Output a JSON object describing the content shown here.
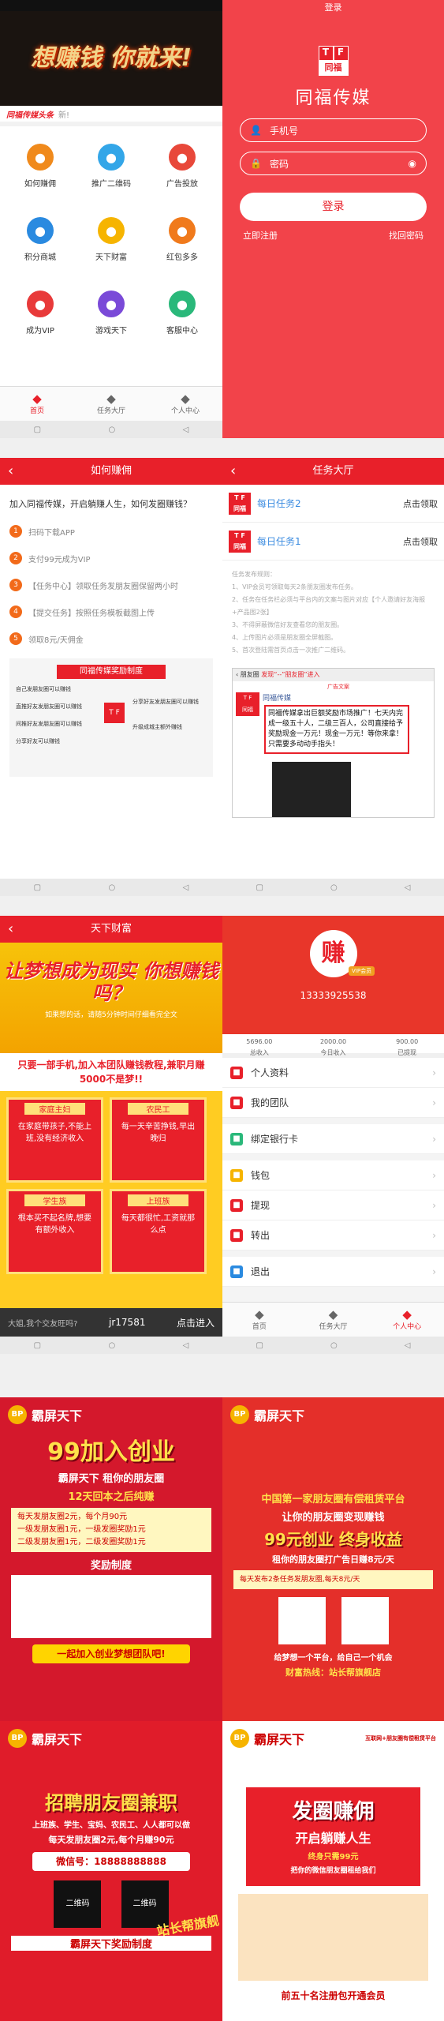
{
  "colors": {
    "brand_red": "#e8202a",
    "link_blue": "#3a8be0",
    "gold": "#f2d48a"
  },
  "panelA": {
    "banner": "想赚钱 你就来!",
    "news_brand": "同福传媒头条",
    "news_text": "新!",
    "grid": [
      {
        "label": "如何赚佣",
        "icon": "coin-icon",
        "color": "#f08a1c"
      },
      {
        "label": "推广二维码",
        "icon": "qr-code-icon",
        "color": "#33a6e8"
      },
      {
        "label": "广告投放",
        "icon": "target-icon",
        "color": "#e8483a"
      },
      {
        "label": "积分商城",
        "icon": "shop-icon",
        "color": "#2a8ae0"
      },
      {
        "label": "天下财富",
        "icon": "wealth-icon",
        "color": "#f6b400"
      },
      {
        "label": "红包多多",
        "icon": "red-packet-icon",
        "color": "#f07a1c"
      },
      {
        "label": "成为VIP",
        "icon": "diamond-icon",
        "color": "#e83a3a"
      },
      {
        "label": "游戏天下",
        "icon": "star-icon",
        "color": "#7a4ad8"
      },
      {
        "label": "客服中心",
        "icon": "headset-icon",
        "color": "#2ab87a"
      }
    ],
    "tabs": [
      {
        "label": "首页",
        "icon": "home-icon",
        "active": true
      },
      {
        "label": "任务大厅",
        "icon": "list-icon",
        "active": false
      },
      {
        "label": "个人中心",
        "icon": "user-icon",
        "active": false
      }
    ]
  },
  "panelB": {
    "title": "登录",
    "logo_t": "T",
    "logo_f": "F",
    "logo_sub": "同福",
    "brand": "同福传媒",
    "phone_placeholder": "手机号",
    "password_placeholder": "密码",
    "login": "登录",
    "register": "立即注册",
    "forgot": "找回密码"
  },
  "panelC": {
    "title": "如何赚佣",
    "intro": "加入同福传媒，开启躺赚人生，如何发圈赚钱？",
    "steps": [
      "扫码下载APP",
      "支付99元成为VIP",
      "【任务中心】领取任务发朋友圈保留两小时",
      "【提交任务】按照任务模板截图上传",
      "领取8元/天佣金"
    ],
    "reward_title": "同福传媒奖励制度",
    "reward_left": [
      "自己发朋友圈可以赚钱",
      "直推好友发朋友圈可以赚钱",
      "间推好友发朋友圈可以赚钱",
      "分享好友可以赚钱"
    ],
    "reward_right": [
      "分享好友发朋友圈可以赚钱",
      "升级成城主额外赚钱"
    ],
    "reward_logo": "T F"
  },
  "panelD": {
    "title": "任务大厅",
    "tasks": [
      {
        "name": "每日任务2",
        "action": "点击领取"
      },
      {
        "name": "每日任务1",
        "action": "点击领取"
      }
    ],
    "rules_title": "任务发布规则：",
    "rules": [
      "1、VIP会员可领取每天2条朋友圈发布任务。",
      "2、任务在任务栏必须与平台内的文案与图片对应【个人邀请好友海报+产品图2张】",
      "3、不得屏蔽微信好友查看您的朋友圈。",
      "4、上传图片必须是朋友圈全屏截图。",
      "5、首次登陆需首页点击一次推广二维码。"
    ],
    "wechat_bar": "朋友圈",
    "wechat_hint": "发现“--”朋友圈”进入",
    "ad_label": "广告文案",
    "post_name": "同福传媒",
    "post_text": "同福传媒拿出巨额奖励市场推广！七天内完成一级五十人，二级三百人，公司直接给予奖励现金一万元！现金一万元！等你来拿！只需要多动动手指头！"
  },
  "panelE": {
    "title": "天下财富",
    "headline": "让梦想成为现实 你想赚钱吗？",
    "sub": "如果想的话，请随5分钟时间仔细看完全文",
    "band": "只要一部手机,加入本团队赚钱教程,兼职月赚5000不是梦!!",
    "cards": [
      {
        "h": "家庭主妇",
        "b": "在家庭带孩子,不能上班,没有经济收入"
      },
      {
        "h": "农民工",
        "b": "每一天辛苦挣钱,早出晚归"
      },
      {
        "h": "学生族",
        "b": "根本买不起名牌,想要有额外收入"
      },
      {
        "h": "上班族",
        "b": "每天都很忙,工资就那么点"
      }
    ],
    "foot_hint": "大姐,我个交友旺吗?",
    "foot_code": "jr17581",
    "foot_action": "点击进入"
  },
  "panelF": {
    "avatar": "赚",
    "badge": "VIP会员",
    "phone": "13333925538",
    "stats": [
      {
        "v": "5696.00",
        "l": "总收入"
      },
      {
        "v": "2000.00",
        "l": "今日收入"
      },
      {
        "v": "900.00",
        "l": "已提现"
      }
    ],
    "menu": [
      {
        "label": "个人资料",
        "icon": "profile-icon",
        "color": "#e8202a"
      },
      {
        "label": "我的团队",
        "icon": "team-icon",
        "color": "#e8202a"
      },
      {
        "label": "绑定银行卡",
        "icon": "bank-card-icon",
        "color": "#2ab87a"
      },
      {
        "label": "钱包",
        "icon": "wallet-icon",
        "color": "#f6b400"
      },
      {
        "label": "提现",
        "icon": "withdraw-icon",
        "color": "#e8202a"
      },
      {
        "label": "转出",
        "icon": "transfer-icon",
        "color": "#e8202a"
      },
      {
        "label": "退出",
        "icon": "power-icon",
        "color": "#2a8ae0"
      }
    ],
    "tabs": [
      {
        "label": "首页",
        "icon": "home-icon",
        "active": false
      },
      {
        "label": "任务大厅",
        "icon": "list-icon",
        "active": false
      },
      {
        "label": "个人中心",
        "icon": "user-icon",
        "active": true
      }
    ]
  },
  "posters": {
    "g": {
      "logo": "霸屏天下",
      "big": "99加入创业",
      "l1": "霸屏天下 租你的朋友圈",
      "l2": "12天回本之后纯赚",
      "box": [
        "每天发朋友圈2元，每个月90元",
        "一级发朋友圈1元，一级发圈奖励1元",
        "二级发朋友圈1元，二级发圈奖励1元"
      ],
      "reward": "奖励制度",
      "btn": "一起加入创业梦想团队吧!"
    },
    "h": {
      "logo": "霸屏天下",
      "l1": "中国第一家朋友圈有偿租赁平台",
      "l2": "让你的朋友圈变现赚钱",
      "big": "99元创业 终身收益",
      "l3": "租你的朋友圈打广告日赚8元/天",
      "l4": "每天发布2条任务发朋友圈,每天8元/天",
      "l5": "财富热线：站长帮旗舰店",
      "l6": "给梦想一个平台，给自己一个机会"
    },
    "i": {
      "logo": "霸屏天下",
      "big": "招聘朋友圈兼职",
      "l1": "上班族、学生、宝妈、农民工、人人都可以做",
      "l2": "每天发朋友圈2元,每个月赚90元",
      "phone_label": "微信号：",
      "phone": "18888888888",
      "qr1": "二维码",
      "qr2": "二维码",
      "foot": "霸屏天下奖励制度",
      "stamp": "站长帮旗舰"
    },
    "j": {
      "logo": "霸屏天下",
      "tag": "互联网+朋友圈有偿租赁平台",
      "big": "发圈赚佣",
      "big2": "开启躺赚人生",
      "l1": "终身只需99元",
      "l2": "把你的微信朋友圈租给我们",
      "foot": "前五十名注册包开通会员"
    }
  }
}
